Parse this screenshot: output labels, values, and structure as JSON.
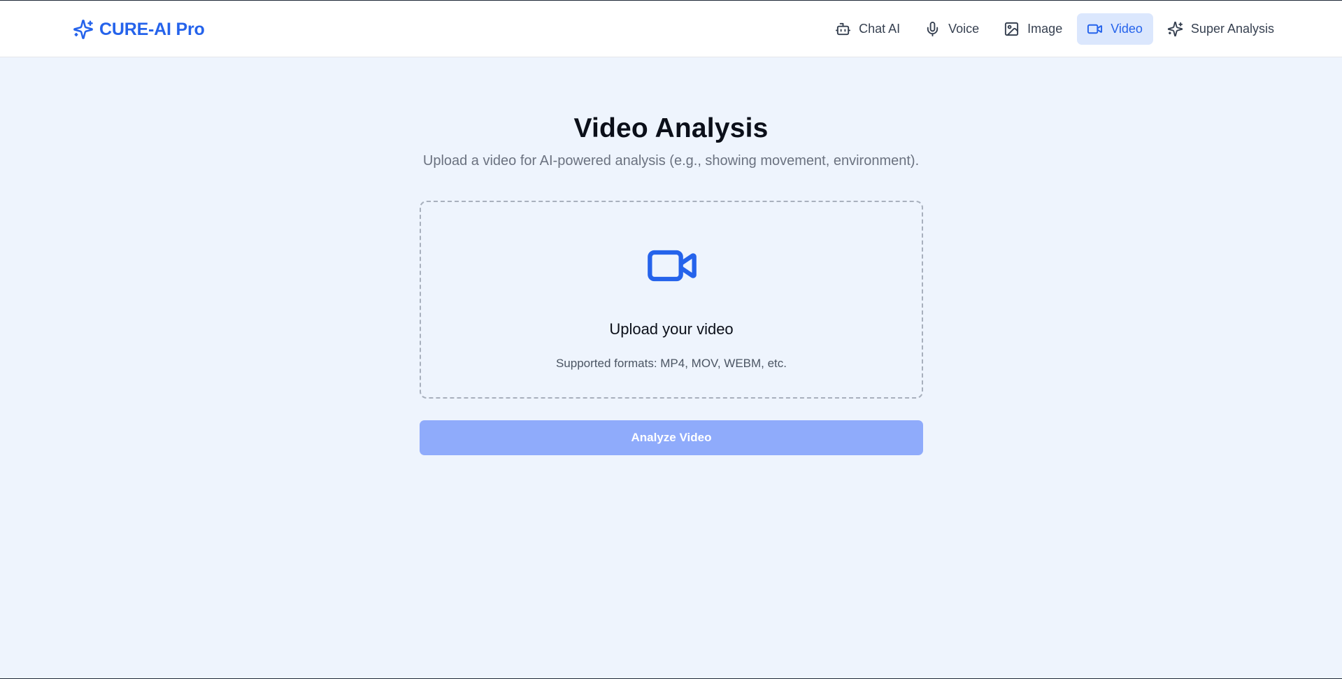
{
  "brand": {
    "name": "CURE-AI Pro",
    "icon": "sparkles-icon",
    "color": "#2563eb"
  },
  "nav": {
    "items": [
      {
        "label": "Chat AI",
        "icon": "bot-icon",
        "active": false
      },
      {
        "label": "Voice",
        "icon": "microphone-icon",
        "active": false
      },
      {
        "label": "Image",
        "icon": "image-icon",
        "active": false
      },
      {
        "label": "Video",
        "icon": "video-camera-icon",
        "active": true
      },
      {
        "label": "Super Analysis",
        "icon": "sparkles-icon",
        "active": false
      }
    ]
  },
  "page": {
    "title": "Video Analysis",
    "subtitle": "Upload a video for AI-powered analysis (e.g., showing movement, environment)."
  },
  "upload": {
    "icon": "video-camera-icon",
    "title": "Upload your video",
    "hint": "Supported formats: MP4, MOV, WEBM, etc."
  },
  "actions": {
    "analyze_label": "Analyze Video",
    "analyze_disabled": true
  },
  "colors": {
    "accent": "#2563eb",
    "background": "#eef4fd",
    "active_nav_bg": "#dbe7fd",
    "button_disabled": "#8fabfb"
  }
}
